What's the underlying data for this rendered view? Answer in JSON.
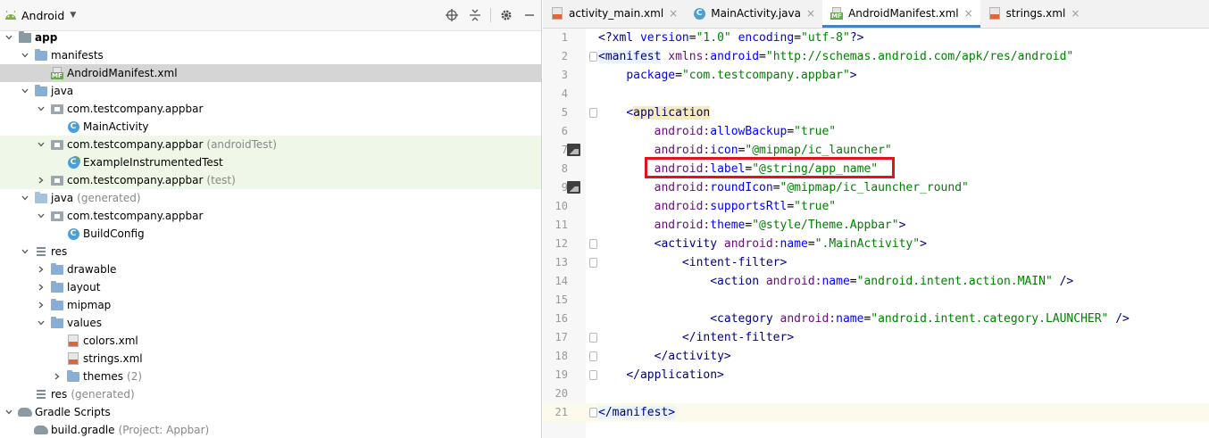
{
  "project_panel": {
    "view_title": "Android",
    "tree": [
      {
        "label": "app",
        "extra": "",
        "depth": 0,
        "expander": "down",
        "icon": "module-folder-icon",
        "bold": true
      },
      {
        "label": "manifests",
        "extra": "",
        "depth": 1,
        "expander": "down",
        "icon": "folder-icon"
      },
      {
        "label": "AndroidManifest.xml",
        "extra": "",
        "depth": 2,
        "expander": "",
        "icon": "manifest-file-icon",
        "selected": true
      },
      {
        "label": "java",
        "extra": "",
        "depth": 1,
        "expander": "down",
        "icon": "folder-icon"
      },
      {
        "label": "com.testcompany.appbar",
        "extra": "",
        "depth": 2,
        "expander": "down",
        "icon": "package-icon"
      },
      {
        "label": "MainActivity",
        "extra": "",
        "depth": 3,
        "expander": "",
        "icon": "class-icon"
      },
      {
        "label": "com.testcompany.appbar",
        "extra": "(androidTest)",
        "depth": 2,
        "expander": "down",
        "icon": "package-icon",
        "test": true
      },
      {
        "label": "ExampleInstrumentedTest",
        "extra": "",
        "depth": 3,
        "expander": "",
        "icon": "test-class-icon",
        "test": true
      },
      {
        "label": "com.testcompany.appbar",
        "extra": "(test)",
        "depth": 2,
        "expander": "right",
        "icon": "package-icon",
        "test": true
      },
      {
        "label": "java",
        "extra": "(generated)",
        "depth": 1,
        "expander": "down",
        "icon": "generated-folder-icon"
      },
      {
        "label": "com.testcompany.appbar",
        "extra": "",
        "depth": 2,
        "expander": "down",
        "icon": "package-icon"
      },
      {
        "label": "BuildConfig",
        "extra": "",
        "depth": 3,
        "expander": "",
        "icon": "class-icon"
      },
      {
        "label": "res",
        "extra": "",
        "depth": 1,
        "expander": "down",
        "icon": "res-folder-icon"
      },
      {
        "label": "drawable",
        "extra": "",
        "depth": 2,
        "expander": "right",
        "icon": "folder-icon"
      },
      {
        "label": "layout",
        "extra": "",
        "depth": 2,
        "expander": "right",
        "icon": "folder-icon"
      },
      {
        "label": "mipmap",
        "extra": "",
        "depth": 2,
        "expander": "right",
        "icon": "folder-icon"
      },
      {
        "label": "values",
        "extra": "",
        "depth": 2,
        "expander": "down",
        "icon": "folder-icon"
      },
      {
        "label": "colors.xml",
        "extra": "",
        "depth": 3,
        "expander": "",
        "icon": "xml-file-icon"
      },
      {
        "label": "strings.xml",
        "extra": "",
        "depth": 3,
        "expander": "",
        "icon": "xml-file-icon"
      },
      {
        "label": "themes",
        "extra": "(2)",
        "depth": 3,
        "expander": "right",
        "icon": "folder-icon"
      },
      {
        "label": "res",
        "extra": "(generated)",
        "depth": 1,
        "expander": "",
        "icon": "res-folder-icon"
      },
      {
        "label": "Gradle Scripts",
        "extra": "",
        "depth": 0,
        "expander": "down",
        "icon": "gradle-icon"
      },
      {
        "label": "build.gradle",
        "extra": "(Project: Appbar)",
        "depth": 1,
        "expander": "",
        "icon": "gradle-icon"
      }
    ]
  },
  "editor": {
    "tabs": [
      {
        "label": "activity_main.xml",
        "icon": "xml-file-icon",
        "active": false
      },
      {
        "label": "MainActivity.java",
        "icon": "class-icon",
        "active": false
      },
      {
        "label": "AndroidManifest.xml",
        "icon": "manifest-file-icon",
        "active": true
      },
      {
        "label": "strings.xml",
        "icon": "xml-file-icon",
        "active": false
      }
    ],
    "lines": [
      {
        "n": "1",
        "tokens": [
          [
            "t-tag",
            "<?xml "
          ],
          [
            "t-attr",
            "version"
          ],
          [
            "t-plain",
            "="
          ],
          [
            "t-val",
            "\"1.0\""
          ],
          [
            "t-plain",
            " "
          ],
          [
            "t-attr",
            "encoding"
          ],
          [
            "t-plain",
            "="
          ],
          [
            "t-val",
            "\"utf-8\""
          ],
          [
            "t-tag",
            "?>"
          ]
        ]
      },
      {
        "n": "2",
        "fold": true,
        "tokens": [
          [
            "t-tag hl-tag2",
            "<manifest"
          ],
          [
            "t-plain",
            " "
          ],
          [
            "t-ns",
            "xmlns:"
          ],
          [
            "t-attr",
            "android"
          ],
          [
            "t-plain",
            "="
          ],
          [
            "t-val",
            "\"http://schemas.android.com/apk/res/android\""
          ]
        ]
      },
      {
        "n": "3",
        "tokens": [
          [
            "t-plain",
            "    "
          ],
          [
            "t-attr",
            "package"
          ],
          [
            "t-plain",
            "="
          ],
          [
            "t-val",
            "\"com.testcompany.appbar\""
          ],
          [
            "t-tag",
            ">"
          ]
        ]
      },
      {
        "n": "4",
        "tokens": []
      },
      {
        "n": "5",
        "fold": true,
        "tokens": [
          [
            "t-plain",
            "    "
          ],
          [
            "t-tag",
            "<"
          ],
          [
            "t-tagname hl-tag",
            "application"
          ]
        ]
      },
      {
        "n": "6",
        "tokens": [
          [
            "t-plain",
            "        "
          ],
          [
            "t-ns",
            "android:"
          ],
          [
            "t-attr",
            "allowBackup"
          ],
          [
            "t-plain",
            "="
          ],
          [
            "t-val",
            "\"true\""
          ]
        ]
      },
      {
        "n": "7",
        "gicon": true,
        "tokens": [
          [
            "t-plain",
            "        "
          ],
          [
            "t-ns",
            "android:"
          ],
          [
            "t-attr",
            "icon"
          ],
          [
            "t-plain",
            "="
          ],
          [
            "t-val",
            "\"@mipmap/ic_launcher\""
          ]
        ]
      },
      {
        "n": "8",
        "tokens": [
          [
            "t-plain",
            "        "
          ],
          [
            "t-ns",
            "android:"
          ],
          [
            "t-attr",
            "label"
          ],
          [
            "t-plain",
            "="
          ],
          [
            "t-val",
            "\"@string/app_name\""
          ]
        ]
      },
      {
        "n": "9",
        "gicon": true,
        "tokens": [
          [
            "t-plain",
            "        "
          ],
          [
            "t-ns",
            "android:"
          ],
          [
            "t-attr",
            "roundIcon"
          ],
          [
            "t-plain",
            "="
          ],
          [
            "t-val",
            "\"@mipmap/ic_launcher_round\""
          ]
        ]
      },
      {
        "n": "10",
        "tokens": [
          [
            "t-plain",
            "        "
          ],
          [
            "t-ns",
            "android:"
          ],
          [
            "t-attr",
            "supportsRtl"
          ],
          [
            "t-plain",
            "="
          ],
          [
            "t-val",
            "\"true\""
          ]
        ]
      },
      {
        "n": "11",
        "tokens": [
          [
            "t-plain",
            "        "
          ],
          [
            "t-ns",
            "android:"
          ],
          [
            "t-attr",
            "theme"
          ],
          [
            "t-plain",
            "="
          ],
          [
            "t-val",
            "\"@style/Theme.Appbar\""
          ],
          [
            "t-tag",
            ">"
          ]
        ]
      },
      {
        "n": "12",
        "fold": true,
        "tokens": [
          [
            "t-plain",
            "        "
          ],
          [
            "t-tag",
            "<activity "
          ],
          [
            "t-ns",
            "android:"
          ],
          [
            "t-attr",
            "name"
          ],
          [
            "t-plain",
            "="
          ],
          [
            "t-val",
            "\".MainActivity\""
          ],
          [
            "t-tag",
            ">"
          ]
        ]
      },
      {
        "n": "13",
        "fold": true,
        "tokens": [
          [
            "t-plain",
            "            "
          ],
          [
            "t-tag",
            "<intent-filter>"
          ]
        ]
      },
      {
        "n": "14",
        "tokens": [
          [
            "t-plain",
            "                "
          ],
          [
            "t-tag",
            "<action "
          ],
          [
            "t-ns",
            "android:"
          ],
          [
            "t-attr",
            "name"
          ],
          [
            "t-plain",
            "="
          ],
          [
            "t-val",
            "\"android.intent.action.MAIN\""
          ],
          [
            "t-plain",
            " "
          ],
          [
            "t-tag",
            "/>"
          ]
        ]
      },
      {
        "n": "15",
        "tokens": []
      },
      {
        "n": "16",
        "tokens": [
          [
            "t-plain",
            "                "
          ],
          [
            "t-tag",
            "<category "
          ],
          [
            "t-ns",
            "android:"
          ],
          [
            "t-attr",
            "name"
          ],
          [
            "t-plain",
            "="
          ],
          [
            "t-val",
            "\"android.intent.category.LAUNCHER\""
          ],
          [
            "t-plain",
            " "
          ],
          [
            "t-tag",
            "/>"
          ]
        ]
      },
      {
        "n": "17",
        "fold": true,
        "tokens": [
          [
            "t-plain",
            "            "
          ],
          [
            "t-tag",
            "</intent-filter>"
          ]
        ]
      },
      {
        "n": "18",
        "fold": true,
        "tokens": [
          [
            "t-plain",
            "        "
          ],
          [
            "t-tag",
            "</activity>"
          ]
        ]
      },
      {
        "n": "19",
        "fold": true,
        "tokens": [
          [
            "t-plain",
            "    "
          ],
          [
            "t-tag",
            "</application>"
          ]
        ]
      },
      {
        "n": "20",
        "tokens": []
      },
      {
        "n": "21",
        "fold": true,
        "current": true,
        "tokens": [
          [
            "t-tag hl-tag2",
            "</manifest>"
          ]
        ]
      }
    ]
  },
  "colors": {
    "selected_row": "#d5d5d5",
    "test_row": "#eff7e8",
    "active_tab_underline": "#4083c9",
    "annotation_box": "#e0131b"
  }
}
